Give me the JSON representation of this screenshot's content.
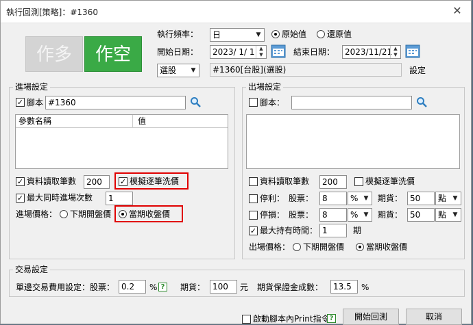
{
  "window": {
    "title": "執行回測[策略]：#1360",
    "close": "✕"
  },
  "buttons": {
    "long": "作多",
    "short": "作空",
    "start": "開始回測",
    "cancel": "取消"
  },
  "top": {
    "freq_label": "執行頻率：",
    "freq_value": "日",
    "radio_orig": "原始值",
    "radio_restore": "還原值",
    "start_label": "開始日期：",
    "start_value": "2023/ 1/ 1",
    "end_label": "結束日期：",
    "end_value": "2023/11/21",
    "select_value": "選股",
    "target_value": "#1360[台股](選股)",
    "setting": "設定"
  },
  "entry": {
    "title": "進場設定",
    "script_label": "腳本",
    "script_value": "#1360",
    "col_name": "參數名稱",
    "col_value": "值",
    "read_bars_label": "資料讀取筆數",
    "read_bars_value": "200",
    "simulate_label": "模擬逐筆洗價",
    "max_entries_label": "最大同時進場次數",
    "max_entries_value": "1",
    "price_label": "進場價格：",
    "price_next_open": "下期開盤價",
    "price_close": "當期收盤價"
  },
  "exit": {
    "title": "出場設定",
    "script_label": "腳本：",
    "script_value": "",
    "read_bars_label": "資料讀取筆數",
    "read_bars_value": "200",
    "simulate_label": "模擬逐筆洗價",
    "tp_label": "停利：",
    "sl_label": "停損：",
    "stock_label": "股票：",
    "futures_label": "期貨：",
    "tp_stock": "8",
    "tp_stock_unit": "%",
    "tp_fut": "50",
    "tp_fut_unit": "點",
    "sl_stock": "8",
    "sl_stock_unit": "%",
    "sl_fut": "50",
    "sl_fut_unit": "點",
    "max_hold_label": "最大持有時間：",
    "max_hold_value": "1",
    "max_hold_unit": "期",
    "price_label": "出場價格：",
    "price_next_open": "下期開盤價",
    "price_close": "當期收盤價"
  },
  "trade": {
    "title": "交易設定",
    "fee_label": "單邊交易費用設定：股票：",
    "fee_value": "0.2",
    "pct": "%",
    "fut_label": "期貨：",
    "fut_value": "100",
    "yuan": "元",
    "margin_label": "期貨保證金成數：",
    "margin_value": "13.5",
    "margin_pct": "%"
  },
  "footer": {
    "print_label": "啟動腳本內Print指令",
    "help": "?"
  }
}
